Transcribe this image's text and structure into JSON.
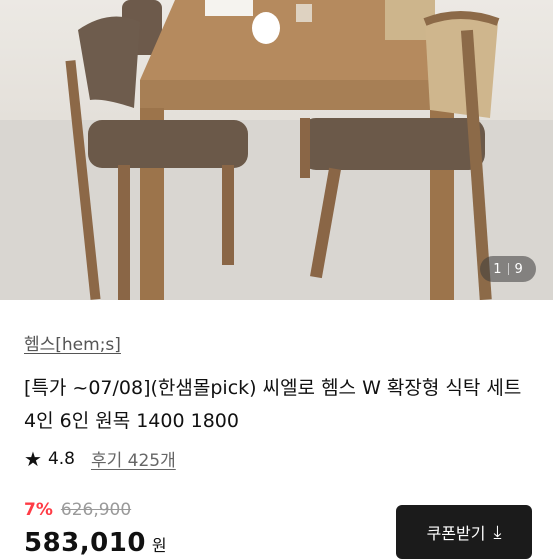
{
  "image": {
    "alt": "wooden extendable dining table with upholstered chairs",
    "counter_current": "1",
    "counter_total": "9"
  },
  "product": {
    "brand": "헴스[hem;s]",
    "title": "[특가 ~07/08](한샘몰pick) 씨엘로 헴스 W 확장형 식탁 세트 4인 6인 원목 1400 1800",
    "rating": "4.8",
    "reviews_label": "후기 425개",
    "discount_rate": "7%",
    "original_price": "626,900",
    "price": "583,010",
    "currency_unit": "원"
  },
  "actions": {
    "coupon_label": "쿠폰받기",
    "coupon_icon": "download-icon"
  },
  "colors": {
    "discount": "#ff3b45",
    "coupon_bg": "#1b1b1b",
    "wood": "#a77f55"
  }
}
